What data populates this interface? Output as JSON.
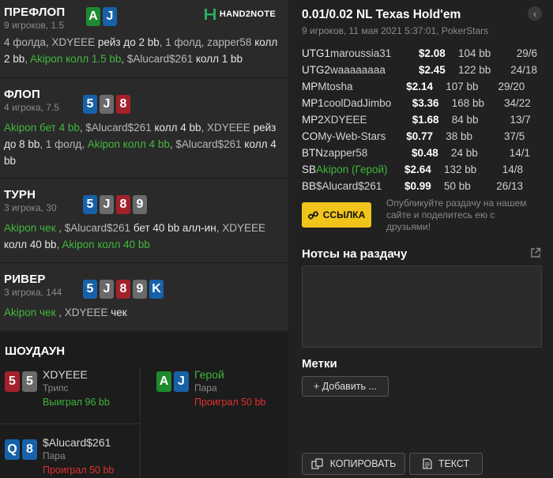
{
  "logo": "HAND2NOTE",
  "preflop": {
    "title": "ПРЕФЛОП",
    "sub": "9 игроков, 1.5",
    "cards": [
      {
        "r": "A",
        "c": "green"
      },
      {
        "r": "J",
        "c": "blue"
      }
    ],
    "action": [
      {
        "t": "4 фолда, XDYEEE ",
        "s": "muted"
      },
      {
        "t": "рейз до 2 bb",
        "s": "normal"
      },
      {
        "t": ", 1 фолд, zapper58 ",
        "s": "muted"
      },
      {
        "t": "колл 2 bb",
        "s": "normal"
      },
      {
        "t": ", ",
        "s": "muted"
      },
      {
        "t": "Akipon колл 1.5 bb",
        "s": "hero"
      },
      {
        "t": ", $Alucard$261 ",
        "s": "muted"
      },
      {
        "t": "колл 1 bb",
        "s": "normal"
      }
    ]
  },
  "flop": {
    "title": "ФЛОП",
    "sub": "4 игрока, 7.5",
    "cards": [
      {
        "r": "5",
        "c": "blue"
      },
      {
        "r": "J",
        "c": "gray"
      },
      {
        "r": "8",
        "c": "red"
      }
    ],
    "action": [
      {
        "t": "Akipon бет 4 bb",
        "s": "hero"
      },
      {
        "t": ", $Alucard$261 ",
        "s": "muted"
      },
      {
        "t": "колл 4 bb",
        "s": "normal"
      },
      {
        "t": ", XDYEEE ",
        "s": "muted"
      },
      {
        "t": "рейз до 8 bb",
        "s": "normal"
      },
      {
        "t": ", 1 фолд, ",
        "s": "muted"
      },
      {
        "t": "Akipon колл 4 bb",
        "s": "hero"
      },
      {
        "t": ", $Alucard$261 ",
        "s": "muted"
      },
      {
        "t": "колл 4 bb",
        "s": "normal"
      }
    ]
  },
  "turn": {
    "title": "ТУРН",
    "sub": "3 игрока, 30",
    "cards": [
      {
        "r": "5",
        "c": "blue"
      },
      {
        "r": "J",
        "c": "gray"
      },
      {
        "r": "8",
        "c": "red"
      },
      {
        "r": "9",
        "c": "gray"
      }
    ],
    "action": [
      {
        "t": "Akipon чек ",
        "s": "hero"
      },
      {
        "t": ", $Alucard$261 ",
        "s": "muted"
      },
      {
        "t": "бет 40 bb алл-ин",
        "s": "normal"
      },
      {
        "t": ", XDYEEE ",
        "s": "muted"
      },
      {
        "t": "колл 40 bb",
        "s": "normal"
      },
      {
        "t": ", ",
        "s": "muted"
      },
      {
        "t": "Akipon колл 40 bb",
        "s": "hero"
      }
    ]
  },
  "river": {
    "title": "РИВЕР",
    "sub": "3 игрока, 144",
    "cards": [
      {
        "r": "5",
        "c": "blue"
      },
      {
        "r": "J",
        "c": "gray"
      },
      {
        "r": "8",
        "c": "red"
      },
      {
        "r": "9",
        "c": "gray"
      },
      {
        "r": "K",
        "c": "blue"
      }
    ],
    "action": [
      {
        "t": "Akipon чек ",
        "s": "hero"
      },
      {
        "t": ", XDYEEE ",
        "s": "muted"
      },
      {
        "t": "чек",
        "s": "normal"
      }
    ]
  },
  "showdown": {
    "title": "ШОУДАУН",
    "players": [
      {
        "name": "XDYEEE",
        "hand": "Трипс",
        "result": "Выиграл 96 bb",
        "win": true,
        "hero": false,
        "cards": [
          {
            "r": "5",
            "c": "red"
          },
          {
            "r": "5",
            "c": "gray"
          }
        ]
      },
      {
        "name": "Герой",
        "hand": "Пара",
        "result": "Проиграл 50 bb",
        "win": false,
        "hero": true,
        "cards": [
          {
            "r": "A",
            "c": "green"
          },
          {
            "r": "J",
            "c": "blue"
          }
        ]
      },
      {
        "name": "$Alucard$261",
        "hand": "Пара",
        "result": "Проиграл 50 bb",
        "win": false,
        "hero": false,
        "cards": [
          {
            "r": "Q",
            "c": "blue"
          },
          {
            "r": "8",
            "c": "blue"
          }
        ]
      }
    ]
  },
  "game": {
    "title": "0.01/0.02 NL Texas Hold'em",
    "sub": "9 игроков, 11 мая 2021 5:37:01, PokerStars",
    "back": "‹"
  },
  "players_table": [
    {
      "pos": "UTG1",
      "name": "maroussia31",
      "stack": "$2.08",
      "bb": "104 bb",
      "vpip": "29/6",
      "hero": false
    },
    {
      "pos": "UTG2",
      "name": "waaaaaaaa",
      "stack": "$2.45",
      "bb": "122 bb",
      "vpip": "24/18",
      "hero": false
    },
    {
      "pos": "MP",
      "name": "Mtosha",
      "stack": "$2.14",
      "bb": "107 bb",
      "vpip": "29/20",
      "hero": false
    },
    {
      "pos": "MP1",
      "name": "coolDadJimbo",
      "stack": "$3.36",
      "bb": "168 bb",
      "vpip": "34/22",
      "hero": false
    },
    {
      "pos": "MP2",
      "name": "XDYEEE",
      "stack": "$1.68",
      "bb": "84 bb",
      "vpip": "13/7",
      "hero": false
    },
    {
      "pos": "CO",
      "name": "My-Web-Stars",
      "stack": "$0.77",
      "bb": "38 bb",
      "vpip": "37/5",
      "hero": false
    },
    {
      "pos": "BTN",
      "name": "zapper58",
      "stack": "$0.48",
      "bb": "24 bb",
      "vpip": "14/1",
      "hero": false
    },
    {
      "pos": "SB",
      "name": "Akipon (Герой)",
      "stack": "$2.64",
      "bb": "132 bb",
      "vpip": "14/8",
      "hero": true
    },
    {
      "pos": "BB",
      "name": "$Alucard$261",
      "stack": "$0.99",
      "bb": "50 bb",
      "vpip": "26/13",
      "hero": false
    }
  ],
  "share": {
    "button": "ССЫЛКА",
    "text": "Опубликуйте раздачу на нашем сайте и поделитесь ею с друзьями!"
  },
  "notes": {
    "title": "Нотсы на раздачу",
    "value": ""
  },
  "marks": {
    "title": "Метки",
    "add": "+ Добавить ..."
  },
  "bottom": {
    "copy": "КОПИРОВАТЬ",
    "text": "ТЕКСТ"
  },
  "colors": {
    "green": "#1e8a2f",
    "blue": "#1761a8",
    "gray": "#6a6a6a",
    "red": "#a2212a",
    "accent": "#f0c419",
    "hero": "#42b83c"
  }
}
